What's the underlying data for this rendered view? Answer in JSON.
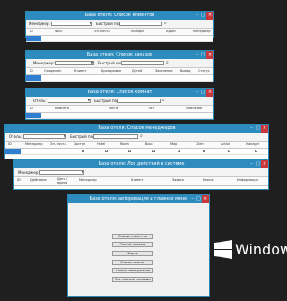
{
  "clients": {
    "title": "База отеля: Список клиентов",
    "manager_label": "Менеджер:",
    "search_label": "Быстрый поиск:",
    "columns": [
      "ID",
      "ФИО",
      "Эл. почта",
      "Телефон",
      "Адрес",
      "Менеджер"
    ]
  },
  "orders": {
    "title": "База отеля: Список заказов",
    "manager_label": "Менеджер:",
    "search_label": "Быстрый поиск:",
    "columns": [
      "ID",
      "Оформлен",
      "Клиент",
      "Бронирован",
      "Детей",
      "Заселение",
      "Выезд",
      "Статус"
    ]
  },
  "rooms": {
    "title": "База отеля: Список комнат",
    "hotel_label": "Отель:",
    "search_label": "Быстрый поиск:",
    "columns": [
      "ID",
      "Комната",
      "Места",
      "Тип",
      "Описание"
    ]
  },
  "managers": {
    "title": "База отеля: Список менеджеров",
    "hotel_label": "Отель:",
    "search_label": "Быстрый поиск:",
    "columns": [
      "ID",
      "Менеджер",
      "Эл. почта",
      "Доступ",
      "Hotel",
      "Room",
      "Book",
      "Map",
      "Client",
      "Action",
      "Manager"
    ]
  },
  "log": {
    "title": "База отеля: Лог действий в системе",
    "manager_label": "Менеджер:",
    "columns": [
      "ID",
      "Действие",
      "Дата / время",
      "Менеджер",
      "Клиент",
      "Заявка",
      "Режим",
      "Информация"
    ]
  },
  "main_menu": {
    "title": "База отеля: авторизация и главное меню",
    "buttons": [
      "Список клиентов",
      "Список заказов",
      "Карта",
      "Список комнат",
      "Список менеджеров",
      "Лог событий системы"
    ]
  },
  "brand": {
    "text": "Windows",
    "accent": "#2e8bbd",
    "close": "#c9373a",
    "selection": "#2f7fd0"
  }
}
